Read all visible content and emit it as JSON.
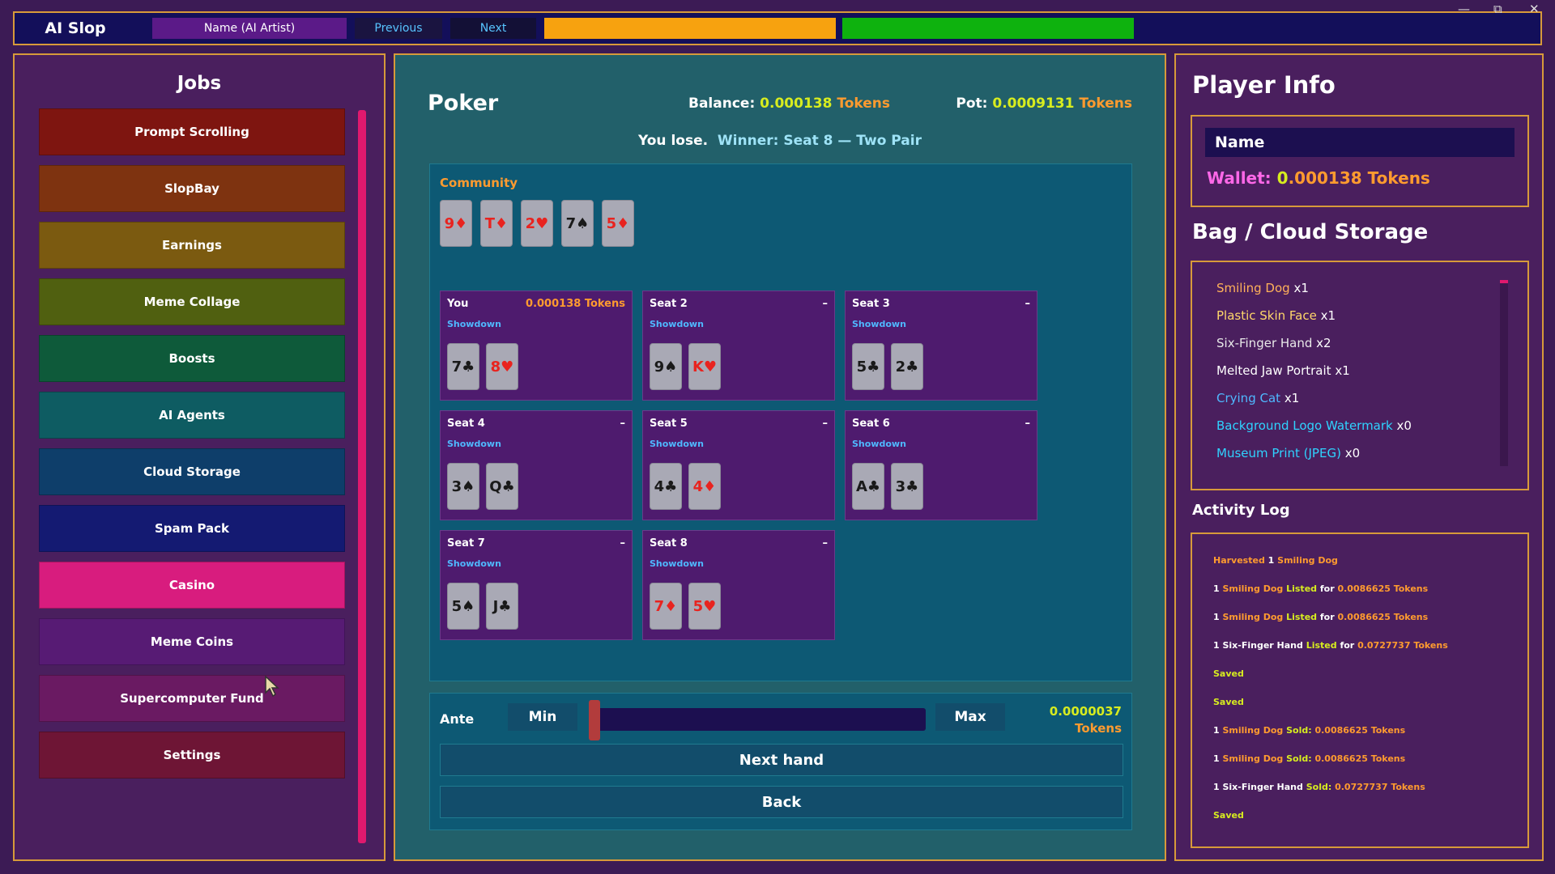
{
  "topbar": {
    "app_title": "AI Slop",
    "name_label": "Name (AI Artist)",
    "previous_label": "Previous",
    "next_label": "Next",
    "window_controls": [
      "—",
      "⧉",
      "✕"
    ]
  },
  "jobs": {
    "title": "Jobs",
    "items": [
      {
        "label": "Prompt Scrolling",
        "color": "#7e1510"
      },
      {
        "label": "SlopBay",
        "color": "#7e3310"
      },
      {
        "label": "Earnings",
        "color": "#7b5a10"
      },
      {
        "label": "Meme Collage",
        "color": "#506010"
      },
      {
        "label": "Boosts",
        "color": "#0e5a3a"
      },
      {
        "label": "AI Agents",
        "color": "#0e5c62"
      },
      {
        "label": "Cloud Storage",
        "color": "#0e3e6a"
      },
      {
        "label": "Spam Pack",
        "color": "#141a72"
      },
      {
        "label": "Casino",
        "color": "#d81c7e"
      },
      {
        "label": "Meme Coins",
        "color": "#571b74"
      },
      {
        "label": "Supercomputer Fund",
        "color": "#6a1a62"
      },
      {
        "label": "Settings",
        "color": "#6e1535"
      }
    ]
  },
  "poker": {
    "title": "Poker",
    "balance_label": "Balance:",
    "balance_value": "0.000138",
    "balance_unit": "Tokens",
    "pot_label": "Pot:",
    "pot_value": "0.0009131",
    "pot_unit": "Tokens",
    "result_text": "You lose.",
    "winner_text": "Winner: Seat 8 — Two Pair",
    "community_label": "Community",
    "community": [
      {
        "rank": "9♦",
        "red": true
      },
      {
        "rank": "T♦",
        "red": true
      },
      {
        "rank": "2♥",
        "red": true
      },
      {
        "rank": "7♠",
        "red": false
      },
      {
        "rank": "5♦",
        "red": true
      }
    ],
    "seats": [
      {
        "name": "You",
        "right": "0.000138 Tokens",
        "status": "Showdown",
        "cards": [
          {
            "rank": "7♣",
            "red": false
          },
          {
            "rank": "8♥",
            "red": true
          }
        ]
      },
      {
        "name": "Seat 2",
        "right": "–",
        "status": "Showdown",
        "cards": [
          {
            "rank": "9♠",
            "red": false
          },
          {
            "rank": "K♥",
            "red": true
          }
        ]
      },
      {
        "name": "Seat 3",
        "right": "–",
        "status": "Showdown",
        "cards": [
          {
            "rank": "5♣",
            "red": false
          },
          {
            "rank": "2♣",
            "red": false
          }
        ]
      },
      {
        "name": "Seat 4",
        "right": "–",
        "status": "Showdown",
        "cards": [
          {
            "rank": "3♠",
            "red": false
          },
          {
            "rank": "Q♣",
            "red": false
          }
        ]
      },
      {
        "name": "Seat 5",
        "right": "–",
        "status": "Showdown",
        "cards": [
          {
            "rank": "4♣",
            "red": false
          },
          {
            "rank": "4♦",
            "red": true
          }
        ]
      },
      {
        "name": "Seat 6",
        "right": "–",
        "status": "Showdown",
        "cards": [
          {
            "rank": "A♣",
            "red": false
          },
          {
            "rank": "3♣",
            "red": false
          }
        ]
      },
      {
        "name": "Seat 7",
        "right": "–",
        "status": "Showdown",
        "cards": [
          {
            "rank": "5♠",
            "red": false
          },
          {
            "rank": "J♣",
            "red": false
          }
        ]
      },
      {
        "name": "Seat 8",
        "right": "–",
        "status": "Showdown",
        "cards": [
          {
            "rank": "7♦",
            "red": true
          },
          {
            "rank": "5♥",
            "red": true
          }
        ]
      }
    ],
    "ante_label": "Ante",
    "min_label": "Min",
    "max_label": "Max",
    "ante_slider_fraction": 0.0,
    "ante_value": "0.0000037",
    "ante_unit": "Tokens",
    "next_hand_label": "Next hand",
    "back_label": "Back"
  },
  "player": {
    "title": "Player Info",
    "name": "Name",
    "wallet_label": "Wallet:",
    "wallet_value_zero": "0",
    "wallet_value": ".000138 Tokens"
  },
  "bag": {
    "title": "Bag / Cloud Storage",
    "items": [
      {
        "name": "Smiling Dog",
        "qty": "x1",
        "color": "#ffb15a"
      },
      {
        "name": "Plastic Skin Face",
        "qty": "x1",
        "color": "#ffd76a"
      },
      {
        "name": "Six-Finger Hand",
        "qty": "x2",
        "color": "#e8e8e8"
      },
      {
        "name": "Melted Jaw Portrait",
        "qty": "x1",
        "color": "#ffffff"
      },
      {
        "name": "Crying Cat",
        "qty": "x1",
        "color": "#4fb8ff"
      },
      {
        "name": "Background Logo Watermark",
        "qty": "x0",
        "color": "#2fd3ff"
      },
      {
        "name": "Museum Print (JPEG)",
        "qty": "x0",
        "color": "#2fd3ff"
      }
    ]
  },
  "log": {
    "title": "Activity Log",
    "items": [
      [
        {
          "t": "Harvested ",
          "c": "c-o"
        },
        {
          "t": "1 ",
          "c": "c-w"
        },
        {
          "t": "Smiling Dog",
          "c": "c-o"
        }
      ],
      [
        {
          "t": "1 ",
          "c": "c-w"
        },
        {
          "t": "Smiling Dog ",
          "c": "c-o"
        },
        {
          "t": "Listed ",
          "c": "c-y"
        },
        {
          "t": "for ",
          "c": "c-w"
        },
        {
          "t": "0.0086625 Tokens",
          "c": "c-o"
        }
      ],
      [
        {
          "t": "1 ",
          "c": "c-w"
        },
        {
          "t": "Smiling Dog ",
          "c": "c-o"
        },
        {
          "t": "Listed ",
          "c": "c-y"
        },
        {
          "t": "for ",
          "c": "c-w"
        },
        {
          "t": "0.0086625 Tokens",
          "c": "c-o"
        }
      ],
      [
        {
          "t": "1 ",
          "c": "c-w"
        },
        {
          "t": "Six-Finger Hand ",
          "c": "c-w"
        },
        {
          "t": "Listed ",
          "c": "c-y"
        },
        {
          "t": "for ",
          "c": "c-w"
        },
        {
          "t": "0.0727737 Tokens",
          "c": "c-o"
        }
      ],
      [
        {
          "t": "Saved",
          "c": "c-y"
        }
      ],
      [
        {
          "t": "Saved",
          "c": "c-y"
        }
      ],
      [
        {
          "t": "1 ",
          "c": "c-w"
        },
        {
          "t": "Smiling Dog ",
          "c": "c-o"
        },
        {
          "t": "Sold: ",
          "c": "c-y"
        },
        {
          "t": "0.0086625 Tokens",
          "c": "c-o"
        }
      ],
      [
        {
          "t": "1 ",
          "c": "c-w"
        },
        {
          "t": "Smiling Dog ",
          "c": "c-o"
        },
        {
          "t": "Sold: ",
          "c": "c-y"
        },
        {
          "t": "0.0086625 Tokens",
          "c": "c-o"
        }
      ],
      [
        {
          "t": "1 ",
          "c": "c-w"
        },
        {
          "t": "Six-Finger Hand ",
          "c": "c-w"
        },
        {
          "t": "Sold: ",
          "c": "c-y"
        },
        {
          "t": "0.0727737 Tokens",
          "c": "c-o"
        }
      ],
      [
        {
          "t": "Saved",
          "c": "c-y"
        }
      ]
    ]
  }
}
